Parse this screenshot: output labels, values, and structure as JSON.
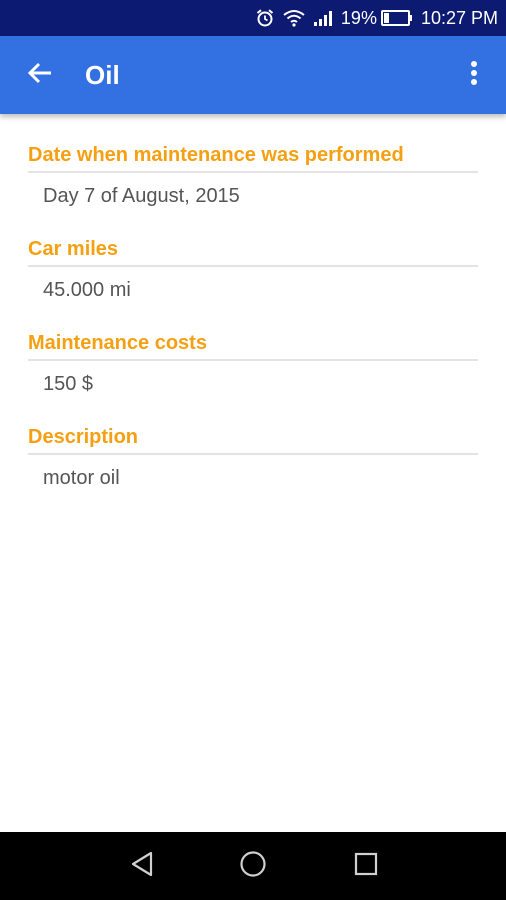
{
  "status_bar": {
    "battery_percent": "19%",
    "time": "10:27 PM"
  },
  "app_bar": {
    "title": "Oil",
    "back_icon": "arrow-back-icon",
    "menu_icon": "more-vert-icon",
    "background": "#3371e3"
  },
  "fields": [
    {
      "label": "Date when maintenance was performed",
      "value": "Day 7 of August, 2015"
    },
    {
      "label": "Car miles",
      "value": "45.000 mi"
    },
    {
      "label": "Maintenance costs",
      "value": "150 $"
    },
    {
      "label": "Description",
      "value": "motor oil"
    }
  ],
  "colors": {
    "accent": "#f5a012",
    "status_bar": "#0d1a72",
    "value_text": "#555555"
  },
  "nav_bar": {
    "icons": [
      "back-triangle-icon",
      "home-circle-icon",
      "recents-square-icon"
    ]
  }
}
